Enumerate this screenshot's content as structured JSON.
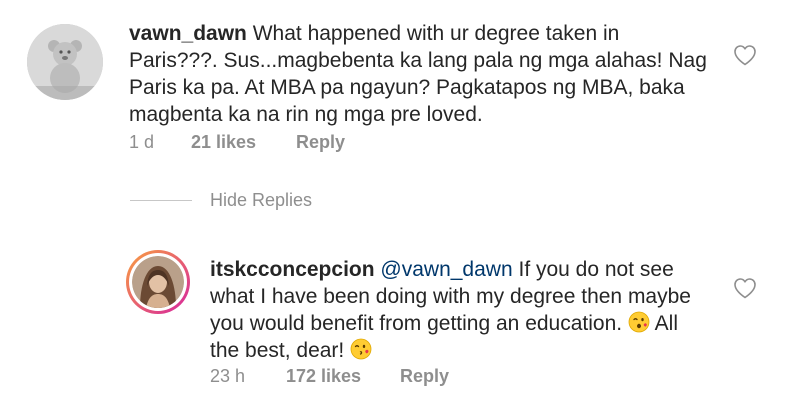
{
  "comments": [
    {
      "username": "vawn_dawn",
      "text": "What happened with ur degree taken in Paris???. Sus...magbebenta ka lang pala ng mga alahas! Nag Paris ka pa. At MBA pa ngayun? Pagkatapos ng MBA, baka magbenta ka na rin ng mga pre loved.",
      "time": "1 d",
      "likes": "21 likes",
      "reply_label": "Reply",
      "avatar_icon": "teddy-bear-avatar",
      "like_icon": "heart-outline-icon"
    }
  ],
  "hide_replies_label": "Hide Replies",
  "reply": {
    "username": "itskcconcepcion",
    "mention": "@vawn_dawn",
    "text_part1": "If you do not see what I have been doing with my degree then maybe you would benefit from getting an education.",
    "text_part2": "All the best, dear!",
    "emoji1": "😉",
    "emoji2": "😘",
    "time": "23 h",
    "likes": "172 likes",
    "reply_label": "Reply",
    "avatar_icon": "profile-photo-avatar",
    "like_icon": "heart-outline-icon"
  },
  "colors": {
    "text": "#262626",
    "meta": "#8e8e8e",
    "story_ring_start": "#f9a03f",
    "story_ring_end": "#d6249f"
  }
}
